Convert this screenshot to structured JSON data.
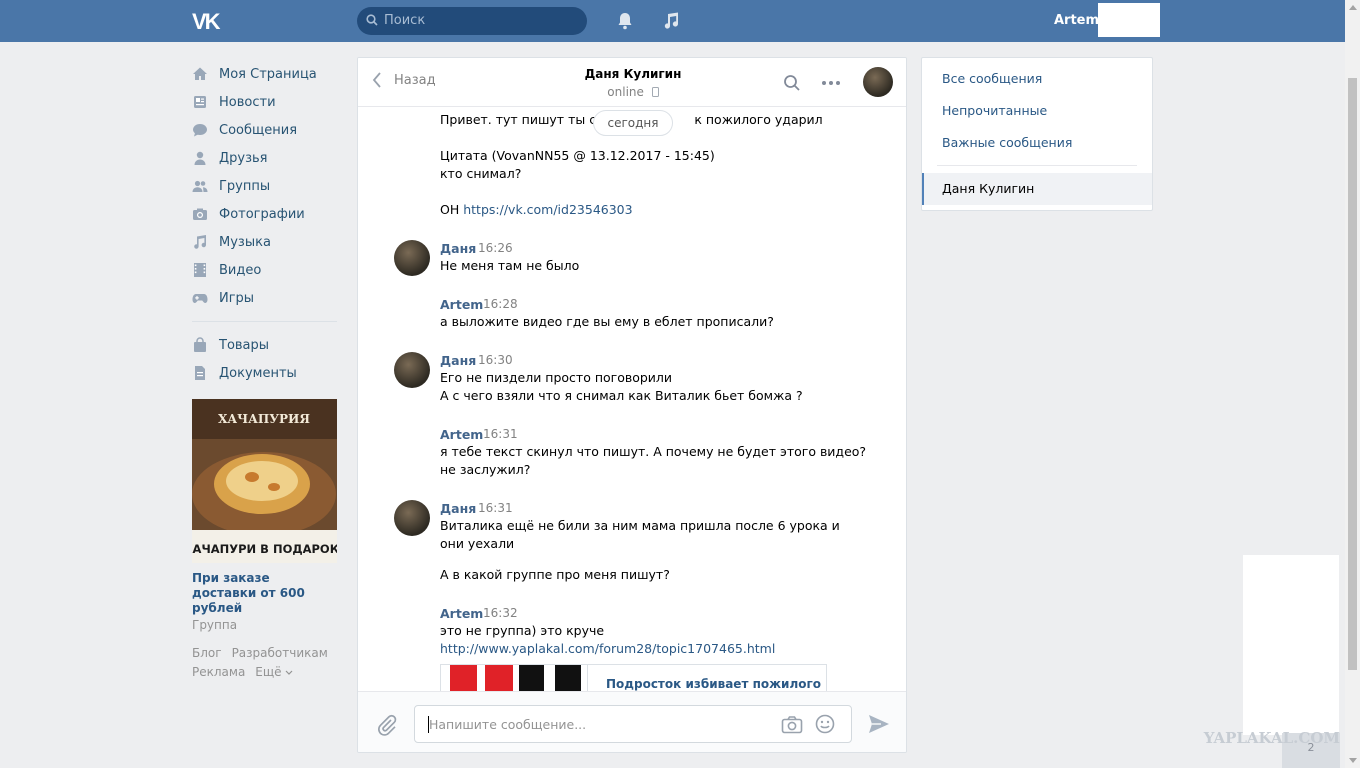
{
  "header": {
    "logo": "VK",
    "search_placeholder": "Поиск",
    "username": "Artem"
  },
  "nav": {
    "items": [
      {
        "label": "Моя Страница",
        "icon": "home-icon"
      },
      {
        "label": "Новости",
        "icon": "news-icon"
      },
      {
        "label": "Сообщения",
        "icon": "messages-icon"
      },
      {
        "label": "Друзья",
        "icon": "friends-icon"
      },
      {
        "label": "Группы",
        "icon": "groups-icon"
      },
      {
        "label": "Фотографии",
        "icon": "camera-icon"
      },
      {
        "label": "Музыка",
        "icon": "music-icon"
      },
      {
        "label": "Видео",
        "icon": "video-icon"
      },
      {
        "label": "Игры",
        "icon": "gamepad-icon"
      }
    ],
    "items2": [
      {
        "label": "Товары",
        "icon": "bag-icon"
      },
      {
        "label": "Документы",
        "icon": "document-icon"
      }
    ]
  },
  "ad": {
    "brand": "ХАЧАПУРИЯ",
    "banner": "ХАЧАПУРИ В ПОДАРОК!",
    "title": "При заказе доставки от 600 рублей",
    "subtitle": "Группа"
  },
  "footer": {
    "links": [
      "Блог",
      "Разработчикам",
      "Реклама",
      "Ещё"
    ]
  },
  "chat": {
    "back_label": "Назад",
    "name": "Даня Кулигин",
    "status": "online",
    "date_divider": "сегодня",
    "input_placeholder": "Напишите сообщение...",
    "messages": {
      "m0_line1": "Привет. тут пишут ты сни",
      "m0_line1_tail": "к пожилого ударил",
      "m0_line2": "Цитата (VovanNN55 @ 13.12.2017 - 15:45)",
      "m0_line3": "кто снимал?",
      "m0_line4_prefix": "ОН",
      "m0_line4_link": "https://vk.com/id23546303",
      "m1_author": "Даня",
      "m1_time": "16:26",
      "m1_line1": "Не меня там не было",
      "m2_author": "Artem",
      "m2_time": "16:28",
      "m2_line1": "а выложите видео где вы ему в еблет прописали?",
      "m3_author": "Даня",
      "m3_time": "16:30",
      "m3_line1": "Его не пиздели просто поговорили",
      "m3_line2": "А с чего взяли что я снимал как Виталик бьет бомжа ?",
      "m4_author": "Artem",
      "m4_time": "16:31",
      "m4_line1": "я тебе текст скинул что пишут. А почему не будет этого видео?",
      "m4_line2": "не заслужил?",
      "m5_author": "Даня",
      "m5_time": "16:31",
      "m5_line1": "Виталика ещё не били за ним мама пришла после 6 урока и",
      "m5_line2": "они уехали",
      "m5_line3": "А в какой группе про меня пишут?",
      "m6_author": "Artem",
      "m6_time": "16:32",
      "m6_line1": "это не группа) это круче",
      "m6_link": "http://www.yaplakal.com/forum28/topic1707465.html",
      "m6_card_title": "Подросток избивает пожилого"
    }
  },
  "right_menu": {
    "all": "Все сообщения",
    "unread": "Непрочитанные",
    "important": "Важные сообщения",
    "active": "Даня Кулигин"
  },
  "watermark": "YAPLAKAL.COM",
  "corner_count": "2"
}
